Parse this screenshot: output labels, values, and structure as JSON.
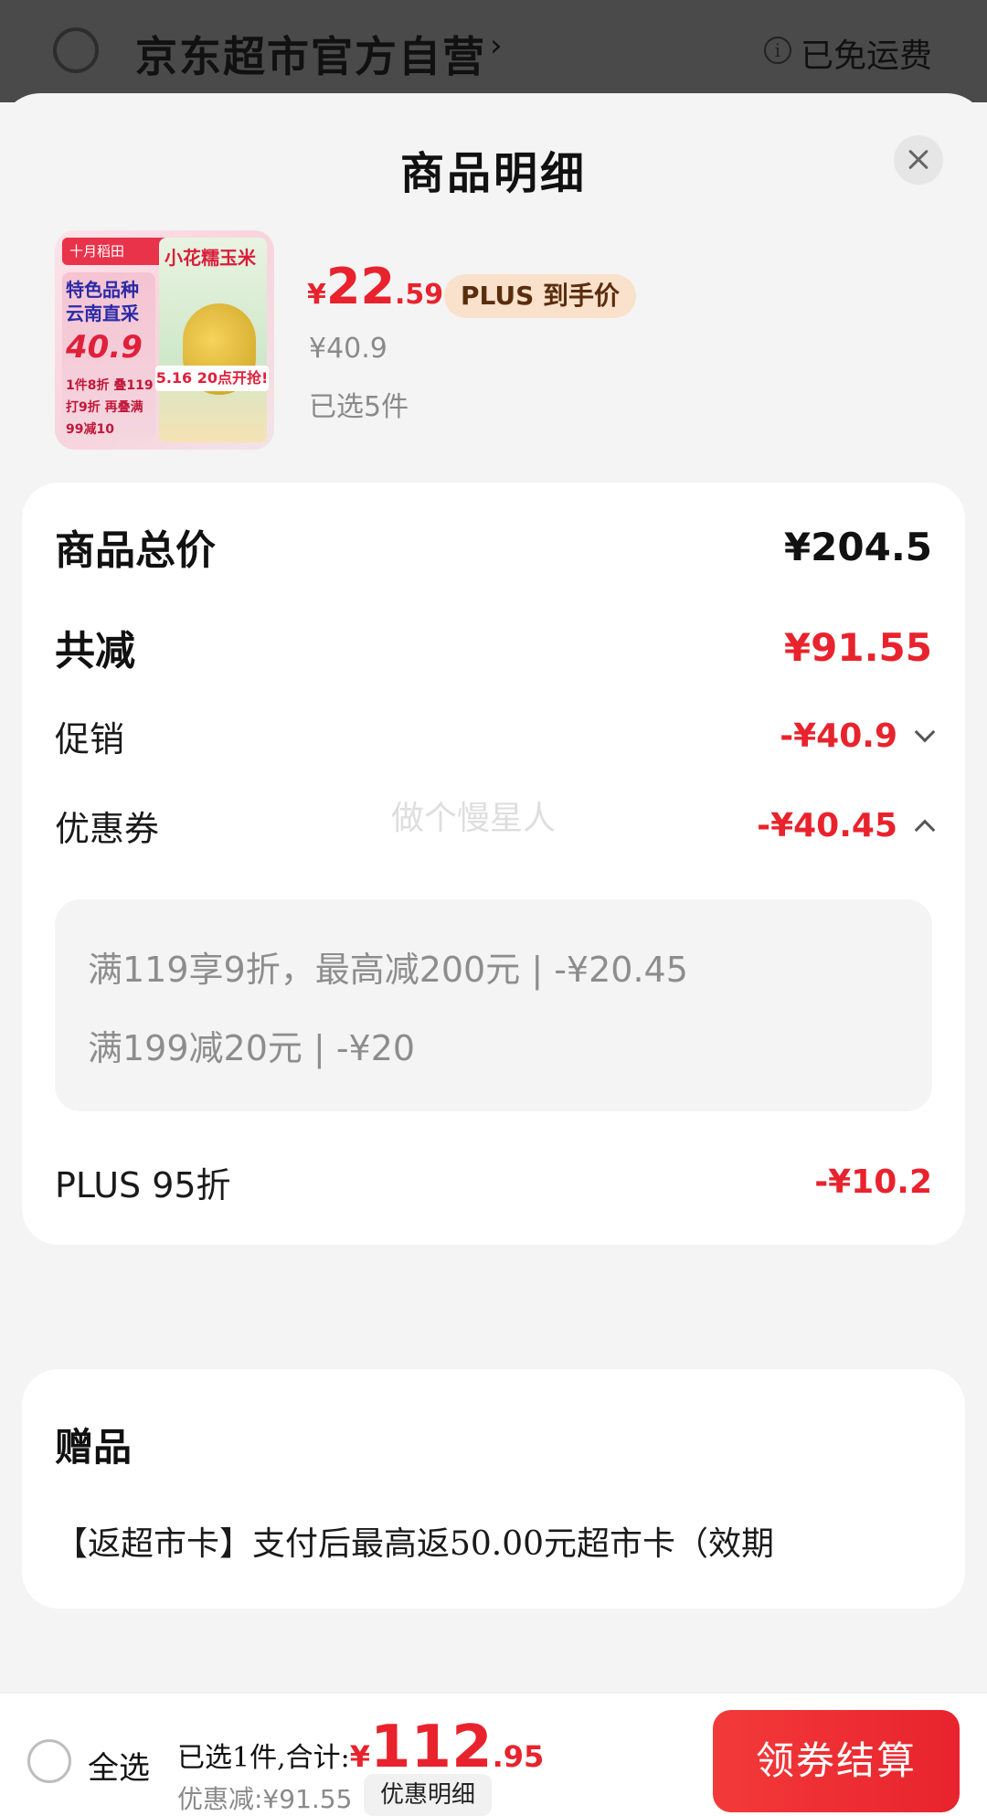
{
  "store": {
    "name": "京东超市官方自营",
    "chevron": "›",
    "info_icon": "ⓘ",
    "shipping": "已免运费"
  },
  "sheet": {
    "title": "商品明细"
  },
  "product": {
    "thumb": {
      "tag": "十月稻田",
      "feature": "特色品种 云南直采",
      "price": "40.9",
      "promo_lines": "1件8折 叠119打9折 再叠满99减10",
      "name": "小花糯玉米",
      "sale": "5.16 20点开抢!"
    },
    "price_currency": "¥",
    "price_int": "22",
    "price_dec": ".59",
    "plus_label": "PLUS 到手价",
    "original_price": "¥40.9",
    "selected": "已选5件"
  },
  "summary": {
    "total_label": "商品总价",
    "total_value": "¥204.5",
    "discount_label": "共减",
    "discount_value": "¥91.55",
    "promo_label": "促销",
    "promo_value": "-¥40.9",
    "coupon_label": "优惠券",
    "coupon_value": "-¥40.45",
    "coupon_lines": [
      "满119享9折，最高减200元 | -¥20.45",
      "满199减20元 | -¥20"
    ],
    "plus_label": "PLUS 95折",
    "plus_value": "-¥10.2"
  },
  "watermark": "做个慢星人",
  "gift": {
    "title": "赠品",
    "text": "【返超市卡】支付后最高返50.00元超市卡（效期"
  },
  "bottom": {
    "select_all": "全选",
    "total_label": "已选1件,合计:",
    "total_currency": "¥",
    "total_int": "112",
    "total_dec": ".95",
    "discount": "优惠减:¥91.55",
    "detail_button": "优惠明细",
    "checkout_button": "领券结算"
  },
  "colors": {
    "accent_red": "#e8232d",
    "plus_tag_bg": "#f9e1cb",
    "plus_tag_text": "#5a2d0e"
  }
}
